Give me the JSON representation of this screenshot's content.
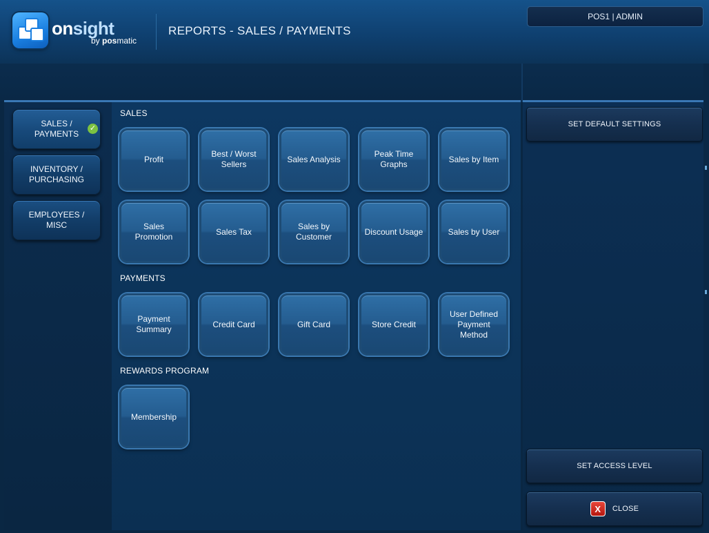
{
  "header": {
    "logo_main_1": "on",
    "logo_main_2": "sight",
    "logo_sub_prefix": "by ",
    "logo_sub_bold": "pos",
    "logo_sub_rest": "matic",
    "page_title": "REPORTS - SALES / PAYMENTS",
    "user_badge": "POS1 | ADMIN"
  },
  "nav": {
    "items": [
      {
        "label_1": "SALES /",
        "label_2": "PAYMENTS",
        "active": true
      },
      {
        "label_1": "INVENTORY /",
        "label_2": "PURCHASING",
        "active": false
      },
      {
        "label_1": "EMPLOYEES /",
        "label_2": "MISC",
        "active": false
      }
    ],
    "active_check": "✓"
  },
  "sections": {
    "sales": {
      "title": "SALES",
      "tiles": [
        "Profit",
        "Best / Worst Sellers",
        "Sales Analysis",
        "Peak Time Graphs",
        "Sales by Item",
        "Sales Promotion",
        "Sales Tax",
        "Sales by Customer",
        "Discount Usage",
        "Sales by User"
      ]
    },
    "payments": {
      "title": "PAYMENTS",
      "tiles": [
        "Payment Summary",
        "Credit Card",
        "Gift Card",
        "Store Credit",
        "User Defined Payment Method"
      ]
    },
    "rewards": {
      "title": "REWARDS PROGRAM",
      "tiles": [
        "Membership"
      ]
    }
  },
  "right": {
    "set_default": "SET DEFAULT SETTINGS",
    "set_access": "SET ACCESS LEVEL",
    "close": "CLOSE",
    "close_icon": "X"
  },
  "colors": {
    "accent": "#3a78b5",
    "check": "#7cc242",
    "close_red": "#c8231a"
  }
}
